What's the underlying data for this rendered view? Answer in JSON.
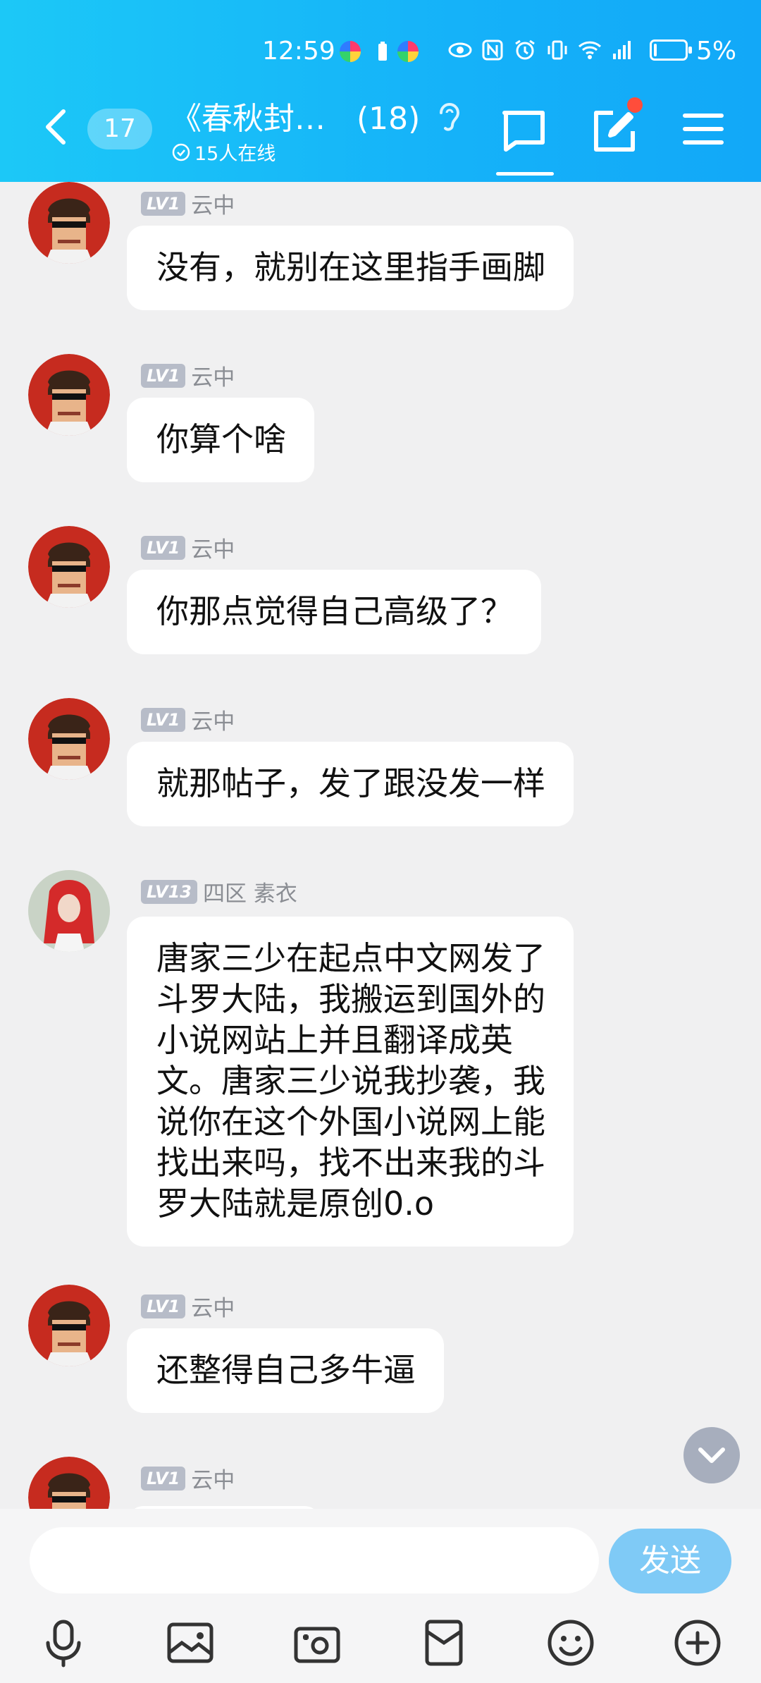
{
  "status": {
    "time": "12:59",
    "battery": "5%"
  },
  "header": {
    "unread": "17",
    "title": "《春秋封…　(18)",
    "online": "15人在线"
  },
  "messages": [
    {
      "level": "LV1",
      "name": "云中",
      "text": "没有，就别在这里指手画脚"
    },
    {
      "level": "LV1",
      "name": "云中",
      "text": "你算个啥"
    },
    {
      "level": "LV1",
      "name": "云中",
      "text": "你那点觉得自己高级了？"
    },
    {
      "level": "LV1",
      "name": "云中",
      "text": "就那帖子，发了跟没发一样"
    },
    {
      "level": "LV13",
      "name": "四区 素衣",
      "text": "唐家三少在起点中文网发了\n斗罗大陆，我搬运到国外的\n小说网站上并且翻译成英\n文。唐家三少说我抄袭，我\n说你在这个外国小说网上能\n找出来吗，找不出来我的斗\n罗大陆就是原创0.o"
    },
    {
      "level": "LV1",
      "name": "云中",
      "text": "还整得自己多牛逼"
    },
    {
      "level": "LV1",
      "name": "云中",
      "text": ""
    }
  ],
  "input": {
    "placeholder": "",
    "send_label": "发送"
  },
  "icons": [
    "back-icon",
    "ear-icon",
    "chat-icon",
    "edit-icon",
    "menu-icon",
    "microphone-icon",
    "image-icon",
    "camera-icon",
    "red-packet-icon",
    "emoji-icon",
    "plus-icon",
    "chevron-down-icon"
  ]
}
